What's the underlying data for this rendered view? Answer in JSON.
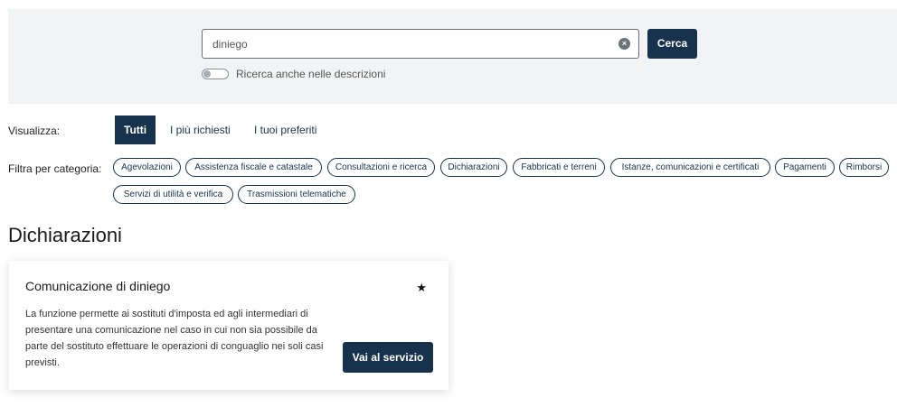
{
  "search": {
    "value": "diniego",
    "button_label": "Cerca",
    "toggle_label": "Ricerca anche nelle descrizioni"
  },
  "view": {
    "label": "Visualizza:",
    "tabs": [
      "Tutti",
      "I più richiesti",
      "I tuoi preferiti"
    ],
    "active": "Tutti"
  },
  "filter": {
    "label": "Filtra per categoria:",
    "chips": [
      "Agevolazioni",
      "Assistenza fiscale e catastale",
      "Consultazioni e ricerca",
      "Dichiarazioni",
      "Fabbricati e terreni",
      "Istanze, comunicazioni e certificati",
      "Pagamenti",
      "Rimborsi",
      "Servizi di utilità e verifica",
      "Trasmissioni telematiche"
    ]
  },
  "section": {
    "title": "Dichiarazioni"
  },
  "card": {
    "title": "Comunicazione di diniego",
    "description": "La funzione permette ai sostituti d'imposta ed agli intermediari di presentare una comunicazione nel caso in cui non sia possibile da parte del sostituto effettuare le operazioni di conguaglio nei soli casi previsti.",
    "button_label": "Vai al servizio",
    "favorite_icon": "star-icon"
  },
  "colors": {
    "primary": "#17324d",
    "band_background": "#f2f3f4"
  }
}
